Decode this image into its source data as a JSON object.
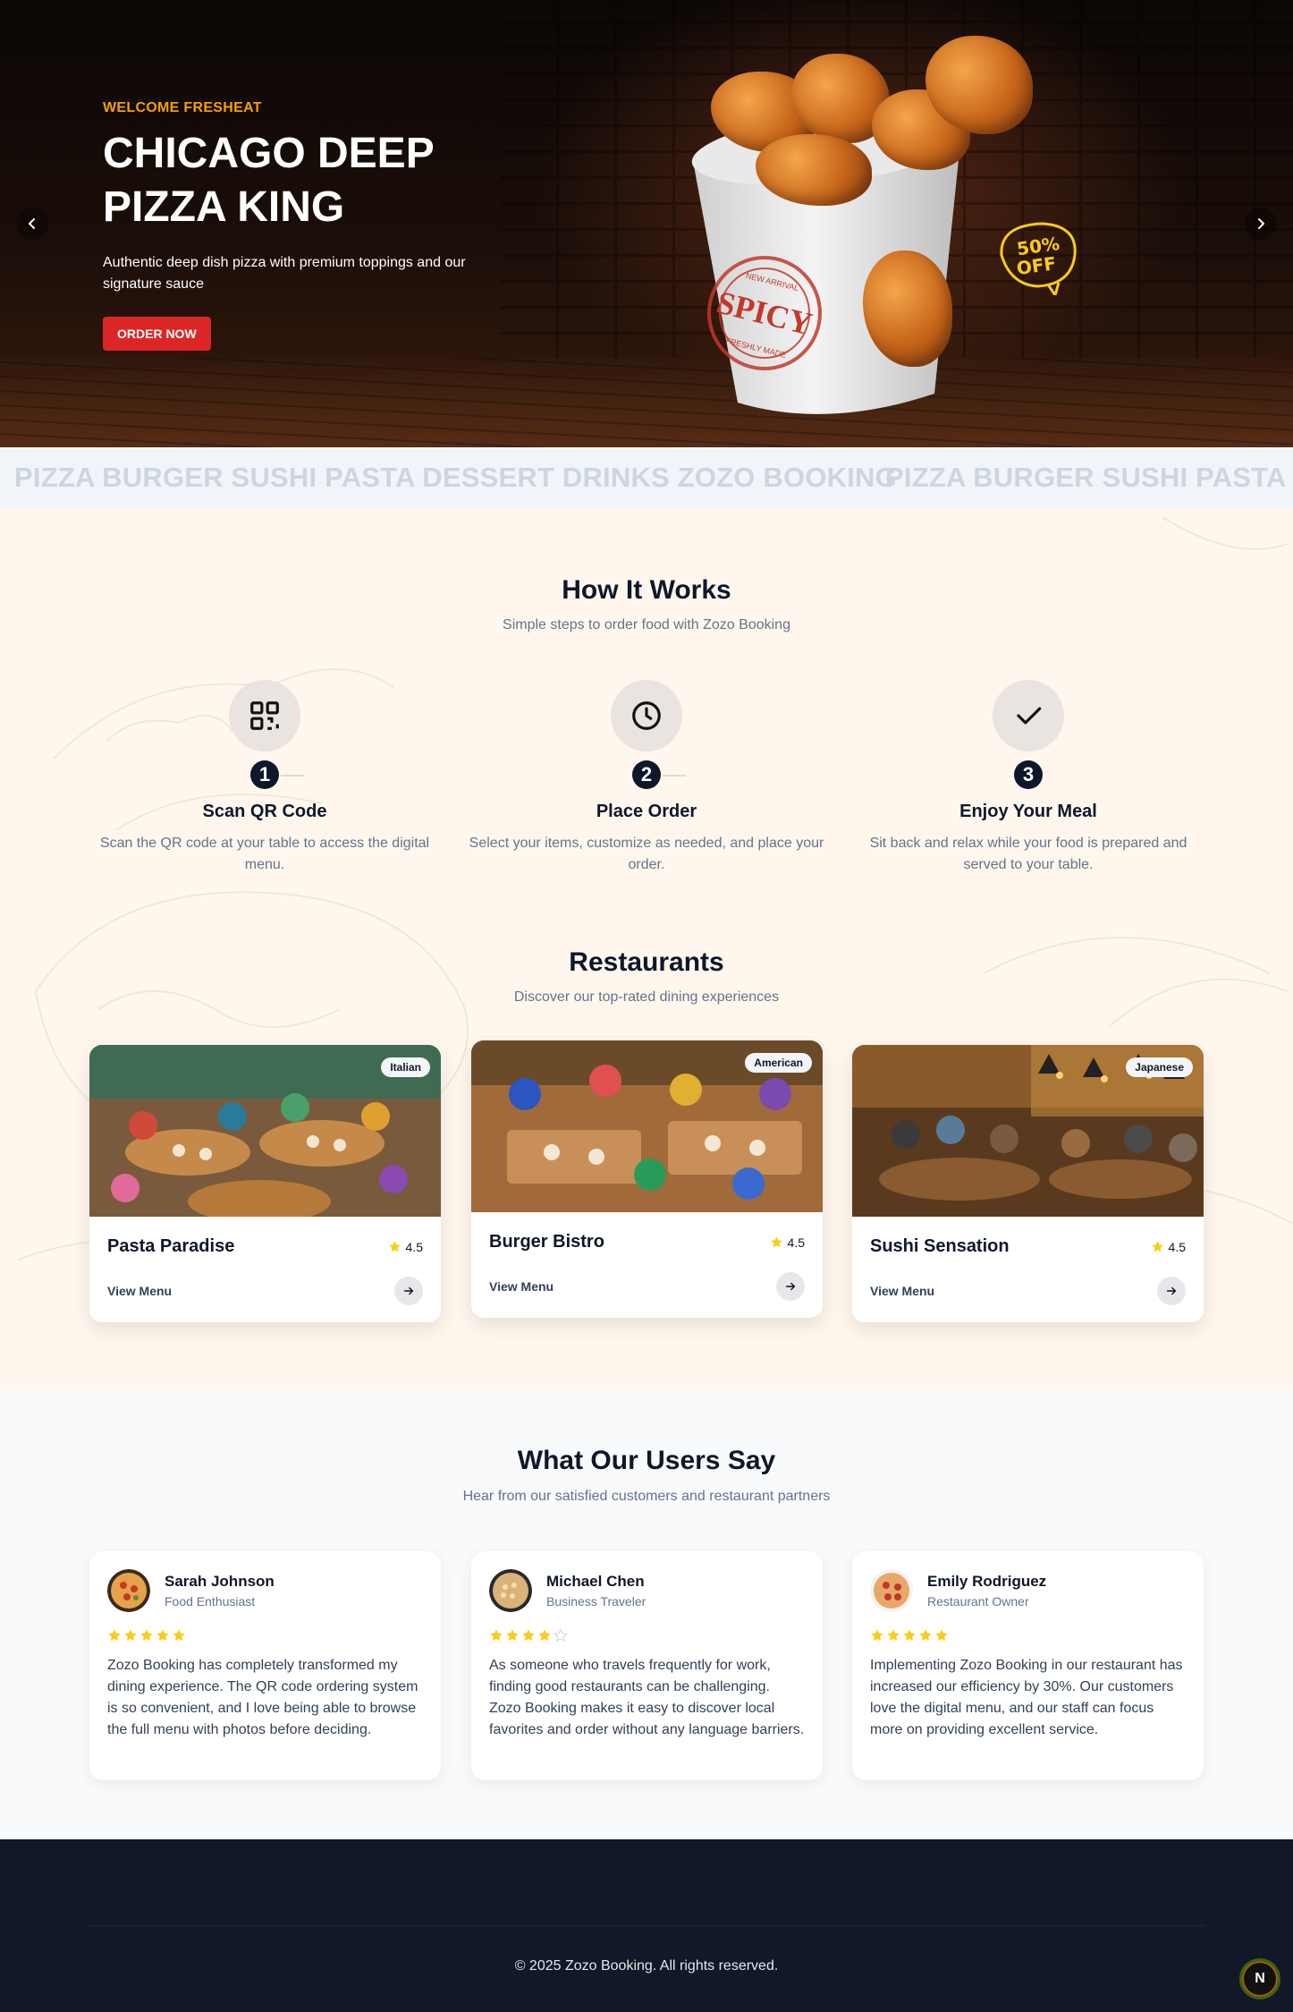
{
  "hero": {
    "eyebrow": "WELCOME FRESHEAT",
    "title": "CHICAGO DEEP PIZZA KING",
    "subtitle": "Authentic deep dish pizza with premium toppings and our signature sauce",
    "cta": "ORDER NOW",
    "prev_icon": "chevron-left-icon",
    "next_icon": "chevron-right-icon",
    "bucket_stamp_main": "SPICY",
    "bucket_stamp_top": "NEW ARRIVAL",
    "bucket_stamp_bottom": "FRESHLY MADE",
    "discount_top": "50%",
    "discount_bottom": "OFF"
  },
  "marquee": {
    "text": "PIZZA BURGER SUSHI PASTA DESSERT DRINKS ZOZO BOOKING"
  },
  "how": {
    "title": "How It Works",
    "subtitle": "Simple steps to order food with Zozo Booking",
    "steps": [
      {
        "number": "1",
        "icon": "qr-code-icon",
        "title": "Scan QR Code",
        "text": "Scan the QR code at your table to access the digital menu."
      },
      {
        "number": "2",
        "icon": "clock-icon",
        "title": "Place Order",
        "text": "Select your items, customize as needed, and place your order."
      },
      {
        "number": "3",
        "icon": "check-icon",
        "title": "Enjoy Your Meal",
        "text": "Sit back and relax while your food is prepared and served to your table."
      }
    ]
  },
  "restaurants": {
    "title": "Restaurants",
    "subtitle": "Discover our top-rated dining experiences",
    "items": [
      {
        "name": "Pasta Paradise",
        "tag": "Italian",
        "rating": "4.5",
        "link": "View Menu"
      },
      {
        "name": "Burger Bistro",
        "tag": "American",
        "rating": "4.5",
        "link": "View Menu"
      },
      {
        "name": "Sushi Sensation",
        "tag": "Japanese",
        "rating": "4.5",
        "link": "View Menu"
      }
    ]
  },
  "testimonials": {
    "title": "What Our Users Say",
    "subtitle": "Hear from our satisfied customers and restaurant partners",
    "items": [
      {
        "name": "Sarah Johnson",
        "role": "Food Enthusiast",
        "stars": 5,
        "text": "Zozo Booking has completely transformed my dining experience. The QR code ordering system is so convenient, and I love being able to browse the full menu with photos before deciding."
      },
      {
        "name": "Michael Chen",
        "role": "Business Traveler",
        "stars": 4,
        "text": "As someone who travels frequently for work, finding good restaurants can be challenging. Zozo Booking makes it easy to discover local favorites and order without any language barriers."
      },
      {
        "name": "Emily Rodriguez",
        "role": "Restaurant Owner",
        "stars": 5,
        "text": "Implementing Zozo Booking in our restaurant has increased our efficiency by 30%. Our customers love the digital menu, and our staff can focus more on providing excellent service."
      }
    ]
  },
  "footer": {
    "copyright": "© 2025 Zozo Booking. All rights reserved.",
    "badge": "N"
  },
  "colors": {
    "accent_red": "#dc2626",
    "accent_amber": "#f59e0b",
    "star": "#facc15",
    "dark": "#0f172a"
  }
}
